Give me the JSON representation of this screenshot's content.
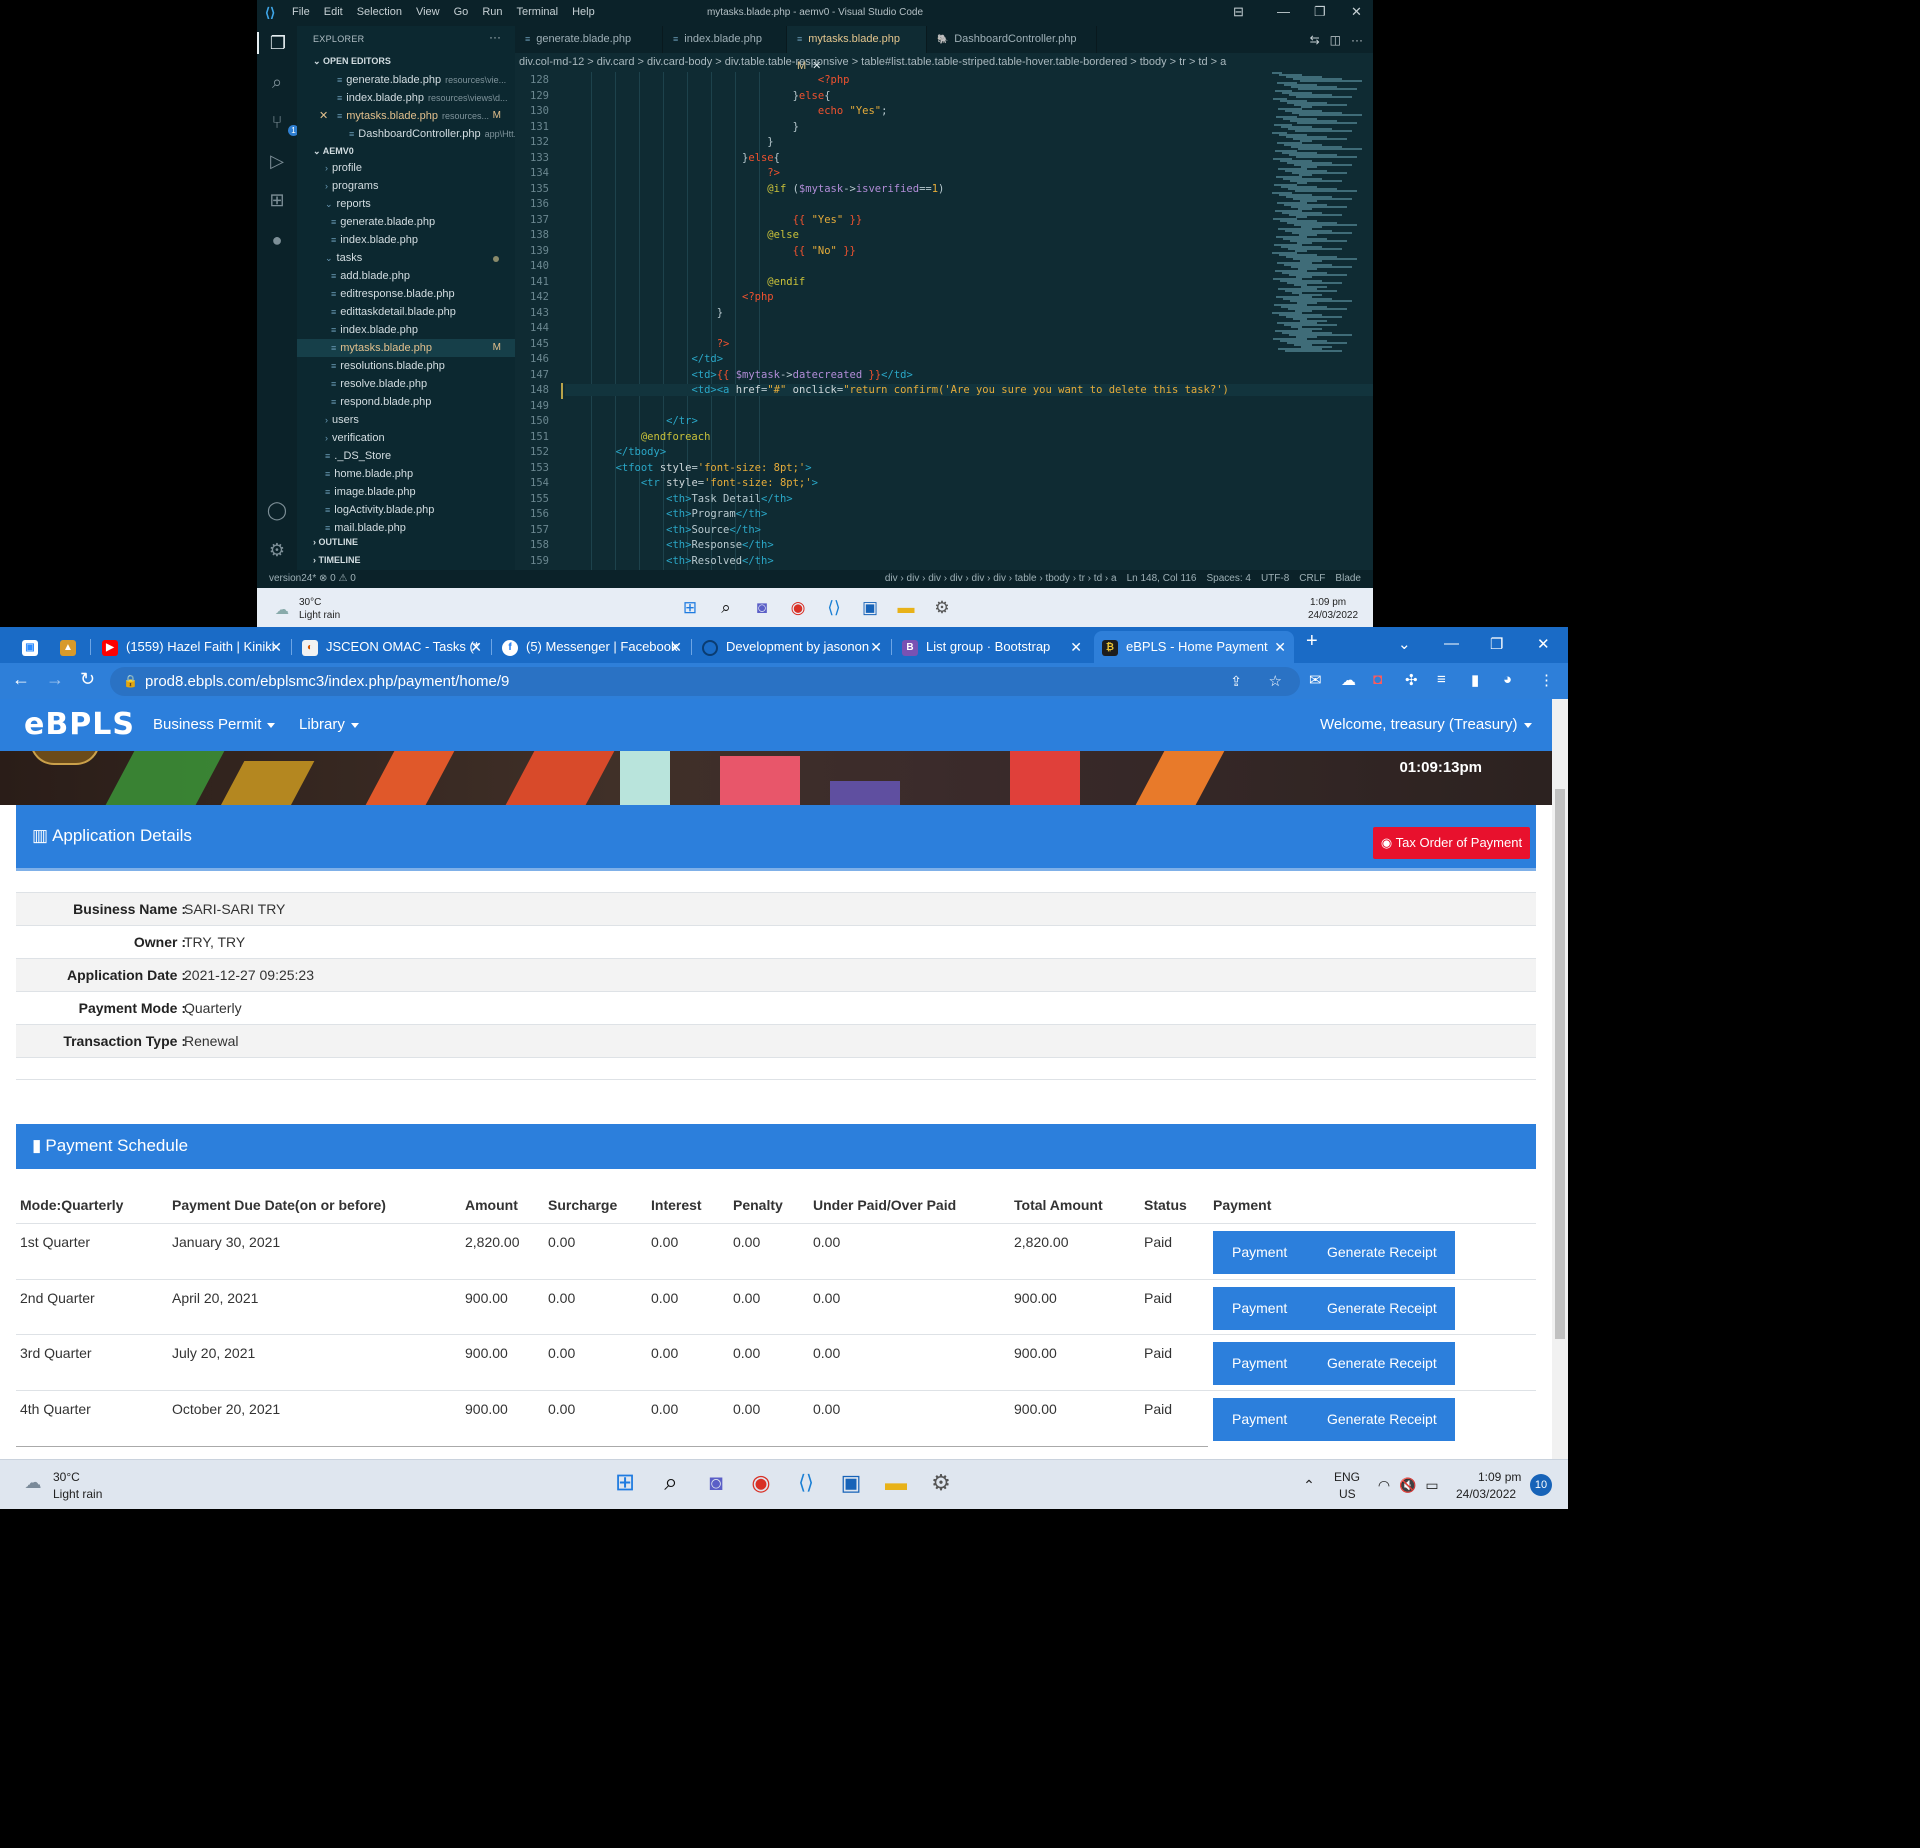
{
  "vscode": {
    "title": "mytasks.blade.php - aemv0 - Visual Studio Code",
    "menu": [
      "File",
      "Edit",
      "Selection",
      "View",
      "Go",
      "Run",
      "Terminal",
      "Help"
    ],
    "explorer_header": "EXPLORER",
    "open_editors_header": "OPEN EDITORS",
    "open_editors": [
      {
        "name": "generate.blade.php",
        "hint": "resources\\vie..."
      },
      {
        "name": "index.blade.php",
        "hint": "resources\\views\\d..."
      },
      {
        "name": "mytasks.blade.php",
        "hint": "resources...",
        "mark": "M"
      },
      {
        "name": "DashboardController.php",
        "hint": "app\\Htt..."
      }
    ],
    "project_header": "AEMV0",
    "tree": [
      {
        "name": "profile",
        "type": "folder"
      },
      {
        "name": "programs",
        "type": "folder"
      },
      {
        "name": "reports",
        "type": "folder-open"
      },
      {
        "name": "generate.blade.php",
        "type": "file"
      },
      {
        "name": "index.blade.php",
        "type": "file"
      },
      {
        "name": "tasks",
        "type": "folder-open"
      },
      {
        "name": "add.blade.php",
        "type": "file"
      },
      {
        "name": "editresponse.blade.php",
        "type": "file"
      },
      {
        "name": "edittaskdetail.blade.php",
        "type": "file"
      },
      {
        "name": "index.blade.php",
        "type": "file"
      },
      {
        "name": "mytasks.blade.php",
        "type": "file",
        "mark": "M"
      },
      {
        "name": "resolutions.blade.php",
        "type": "file"
      },
      {
        "name": "resolve.blade.php",
        "type": "file"
      },
      {
        "name": "respond.blade.php",
        "type": "file"
      },
      {
        "name": "users",
        "type": "folder"
      },
      {
        "name": "verification",
        "type": "folder"
      },
      {
        "name": "._DS_Store",
        "type": "file"
      },
      {
        "name": "home.blade.php",
        "type": "file"
      },
      {
        "name": "image.blade.php",
        "type": "file"
      },
      {
        "name": "logActivity.blade.php",
        "type": "file"
      },
      {
        "name": "mail.blade.php",
        "type": "file"
      }
    ],
    "outline_header": "OUTLINE",
    "timeline_header": "TIMELINE",
    "tabs": [
      {
        "label": "generate.blade.php"
      },
      {
        "label": "index.blade.php"
      },
      {
        "label": "mytasks.blade.php",
        "mark": "M"
      },
      {
        "label": "DashboardController.php"
      }
    ],
    "breadcrumb": "div.col-md-12 > div.card > div.card-body > div.table.table-responsive > table#list.table.table-striped.table-hover.table-bordered > tbody > tr > td > a",
    "code_lines": [
      {
        "n": "128",
        "html": "                                        <span class=\"k\">&lt;?php</span>"
      },
      {
        "n": "129",
        "html": "                                    }<span class=\"k\">else</span>{"
      },
      {
        "n": "130",
        "html": "                                        <span class=\"k\">echo</span> <span class=\"s\">\"Yes\"</span>;"
      },
      {
        "n": "131",
        "html": "                                    }"
      },
      {
        "n": "132",
        "html": "                                }"
      },
      {
        "n": "133",
        "html": "                            }<span class=\"k\">else</span>{"
      },
      {
        "n": "134",
        "html": "                                <span class=\"k\">?&gt;</span>"
      },
      {
        "n": "135",
        "html": "                                <span class=\"v\">@if</span> (<span class=\"p\">$mytask</span>-&gt;<span class=\"p\">isverified</span>==<span class=\"s\">1</span>)"
      },
      {
        "n": "136",
        "html": ""
      },
      {
        "n": "137",
        "html": "                                    <span class=\"k\">{{</span> <span class=\"s\">\"Yes\"</span> <span class=\"k\">}}</span>"
      },
      {
        "n": "138",
        "html": "                                <span class=\"v\">@else</span>"
      },
      {
        "n": "139",
        "html": "                                    <span class=\"k\">{{</span> <span class=\"s\">\"No\"</span> <span class=\"k\">}}</span>"
      },
      {
        "n": "140",
        "html": ""
      },
      {
        "n": "141",
        "html": "                                <span class=\"v\">@endif</span>"
      },
      {
        "n": "142",
        "html": "                            <span class=\"k\">&lt;?php</span>"
      },
      {
        "n": "143",
        "html": "                        }"
      },
      {
        "n": "144",
        "html": ""
      },
      {
        "n": "145",
        "html": "                        <span class=\"k\">?&gt;</span>"
      },
      {
        "n": "146",
        "html": "                    <span class=\"t\">&lt;/td&gt;</span>"
      },
      {
        "n": "147",
        "html": "                    <span class=\"t\">&lt;td&gt;</span><span class=\"k\">{{</span> <span class=\"p\">$mytask</span>-&gt;<span class=\"p\">datecreated</span> <span class=\"k\">}}</span><span class=\"t\">&lt;/td&gt;</span>"
      },
      {
        "n": "148",
        "html": "                    <span class=\"t\">&lt;td&gt;&lt;a</span> <span class=\"a\">href</span>=<span class=\"s\">\"#\"</span> <span class=\"a\">onclick</span>=<span class=\"s\">\"return confirm('Are you sure you want to delete this task?')</span>"
      },
      {
        "n": "149",
        "html": ""
      },
      {
        "n": "150",
        "html": "                <span class=\"t\">&lt;/tr&gt;</span>"
      },
      {
        "n": "151",
        "html": "            <span class=\"v\">@endforeach</span>"
      },
      {
        "n": "152",
        "html": "        <span class=\"t\">&lt;/tbody&gt;</span>"
      },
      {
        "n": "153",
        "html": "        <span class=\"t\">&lt;tfoot</span> <span class=\"a\">style</span>=<span class=\"s\">'font-size: 8pt;'</span><span class=\"t\">&gt;</span>"
      },
      {
        "n": "154",
        "html": "            <span class=\"t\">&lt;tr</span> <span class=\"a\">style</span>=<span class=\"s\">'font-size: 8pt;'</span><span class=\"t\">&gt;</span>"
      },
      {
        "n": "155",
        "html": "                <span class=\"t\">&lt;th&gt;</span>Task Detail<span class=\"t\">&lt;/th&gt;</span>"
      },
      {
        "n": "156",
        "html": "                <span class=\"t\">&lt;th&gt;</span>Program<span class=\"t\">&lt;/th&gt;</span>"
      },
      {
        "n": "157",
        "html": "                <span class=\"t\">&lt;th&gt;</span>Source<span class=\"t\">&lt;/th&gt;</span>"
      },
      {
        "n": "158",
        "html": "                <span class=\"t\">&lt;th&gt;</span>Response<span class=\"t\">&lt;/th&gt;</span>"
      },
      {
        "n": "159",
        "html": "                <span class=\"t\">&lt;th&gt;</span>Resolved<span class=\"t\">&lt;/th&gt;</span>"
      }
    ],
    "status_left": "version24*   ⊗ 0 ⚠ 0",
    "status_right": [
      "div › div › div › div › div › div › table › tbody › tr › td › a",
      "Ln 148, Col 116",
      "Spaces: 4",
      "UTF-8",
      "CRLF",
      "Blade"
    ]
  },
  "inner_taskbar": {
    "weather_temp": "30°C",
    "weather_desc": "Light rain",
    "time": "1:09 pm",
    "date": "24/03/2022"
  },
  "chrome": {
    "tabs": [
      {
        "label": "(1559) Hazel Faith | Kiniki"
      },
      {
        "label": "JSCEON OMAC - Tasks (*"
      },
      {
        "label": "(5) Messenger | Facebook"
      },
      {
        "label": "Development by jasonon"
      },
      {
        "label": "List group · Bootstrap"
      },
      {
        "label": "eBPLS - Home Payment",
        "active": true
      }
    ],
    "url": "prod8.ebpls.com/ebplsmc3/index.php/payment/home/9"
  },
  "page": {
    "brand": "eBPLS",
    "nav": [
      "Business Permit",
      "Library"
    ],
    "welcome": "Welcome, treasury (Treasury)",
    "clock": "01:09:13pm",
    "app_details_title": "Application Details",
    "tax_button": "Tax Order of Payment",
    "details": [
      {
        "label": "Business Name :",
        "value": "SARI-SARI TRY"
      },
      {
        "label": "Owner :",
        "value": "TRY, TRY"
      },
      {
        "label": "Application Date :",
        "value": "2021-12-27 09:25:23"
      },
      {
        "label": "Payment Mode :",
        "value": "Quarterly"
      },
      {
        "label": "Transaction Type :",
        "value": "Renewal"
      }
    ],
    "schedule_title": "Payment Schedule",
    "schedule_headers": [
      "Mode:Quarterly",
      "Payment Due Date(on or before)",
      "Amount",
      "Surcharge",
      "Interest",
      "Penalty",
      "Under Paid/Over Paid",
      "Total Amount",
      "Status",
      "Payment"
    ],
    "schedule_rows": [
      {
        "mode": "1st Quarter",
        "due": "January 30, 2021",
        "amount": "2,820.00",
        "surcharge": "0.00",
        "interest": "0.00",
        "penalty": "0.00",
        "underover": "0.00",
        "total": "2,820.00",
        "status": "Paid"
      },
      {
        "mode": "2nd Quarter",
        "due": "April 20, 2021",
        "amount": "900.00",
        "surcharge": "0.00",
        "interest": "0.00",
        "penalty": "0.00",
        "underover": "0.00",
        "total": "900.00",
        "status": "Paid"
      },
      {
        "mode": "3rd Quarter",
        "due": "July 20, 2021",
        "amount": "900.00",
        "surcharge": "0.00",
        "interest": "0.00",
        "penalty": "0.00",
        "underover": "0.00",
        "total": "900.00",
        "status": "Paid"
      },
      {
        "mode": "4th Quarter",
        "due": "October 20, 2021",
        "amount": "900.00",
        "surcharge": "0.00",
        "interest": "0.00",
        "penalty": "0.00",
        "underover": "0.00",
        "total": "900.00",
        "status": "Paid"
      }
    ],
    "btn_payment": "Payment",
    "btn_receipt": "Generate Receipt"
  },
  "taskbar": {
    "weather_temp": "30°C",
    "weather_desc": "Light rain",
    "lang1": "ENG",
    "lang2": "US",
    "time": "1:09 pm",
    "date": "24/03/2022",
    "notif_count": "10"
  }
}
